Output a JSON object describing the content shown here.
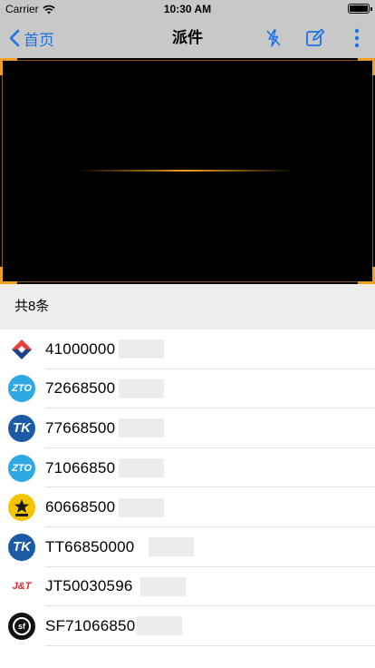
{
  "status_bar": {
    "carrier": "Carrier",
    "time": "10:30 AM"
  },
  "nav": {
    "back_label": "首页",
    "title": "派件"
  },
  "list_header": {
    "count_text": "共8条"
  },
  "items": [
    {
      "carrier_logo": "ems-logo",
      "tracking_number": "41000000"
    },
    {
      "carrier_logo": "zto-logo",
      "tracking_number": "72668500"
    },
    {
      "carrier_logo": "tk-logo",
      "tracking_number": "77668500"
    },
    {
      "carrier_logo": "zto-logo",
      "tracking_number": "71066850"
    },
    {
      "carrier_logo": "star-logo",
      "tracking_number": "60668500"
    },
    {
      "carrier_logo": "tk-logo",
      "tracking_number": "TT66850000"
    },
    {
      "carrier_logo": "jt-logo",
      "tracking_number": "JT50030596"
    },
    {
      "carrier_logo": "sf-logo",
      "tracking_number": "SF71066850"
    }
  ],
  "colors": {
    "accent": "#1a73e8",
    "scanner_frame": "#f0a020",
    "bar_bg": "#c8c8c8"
  }
}
